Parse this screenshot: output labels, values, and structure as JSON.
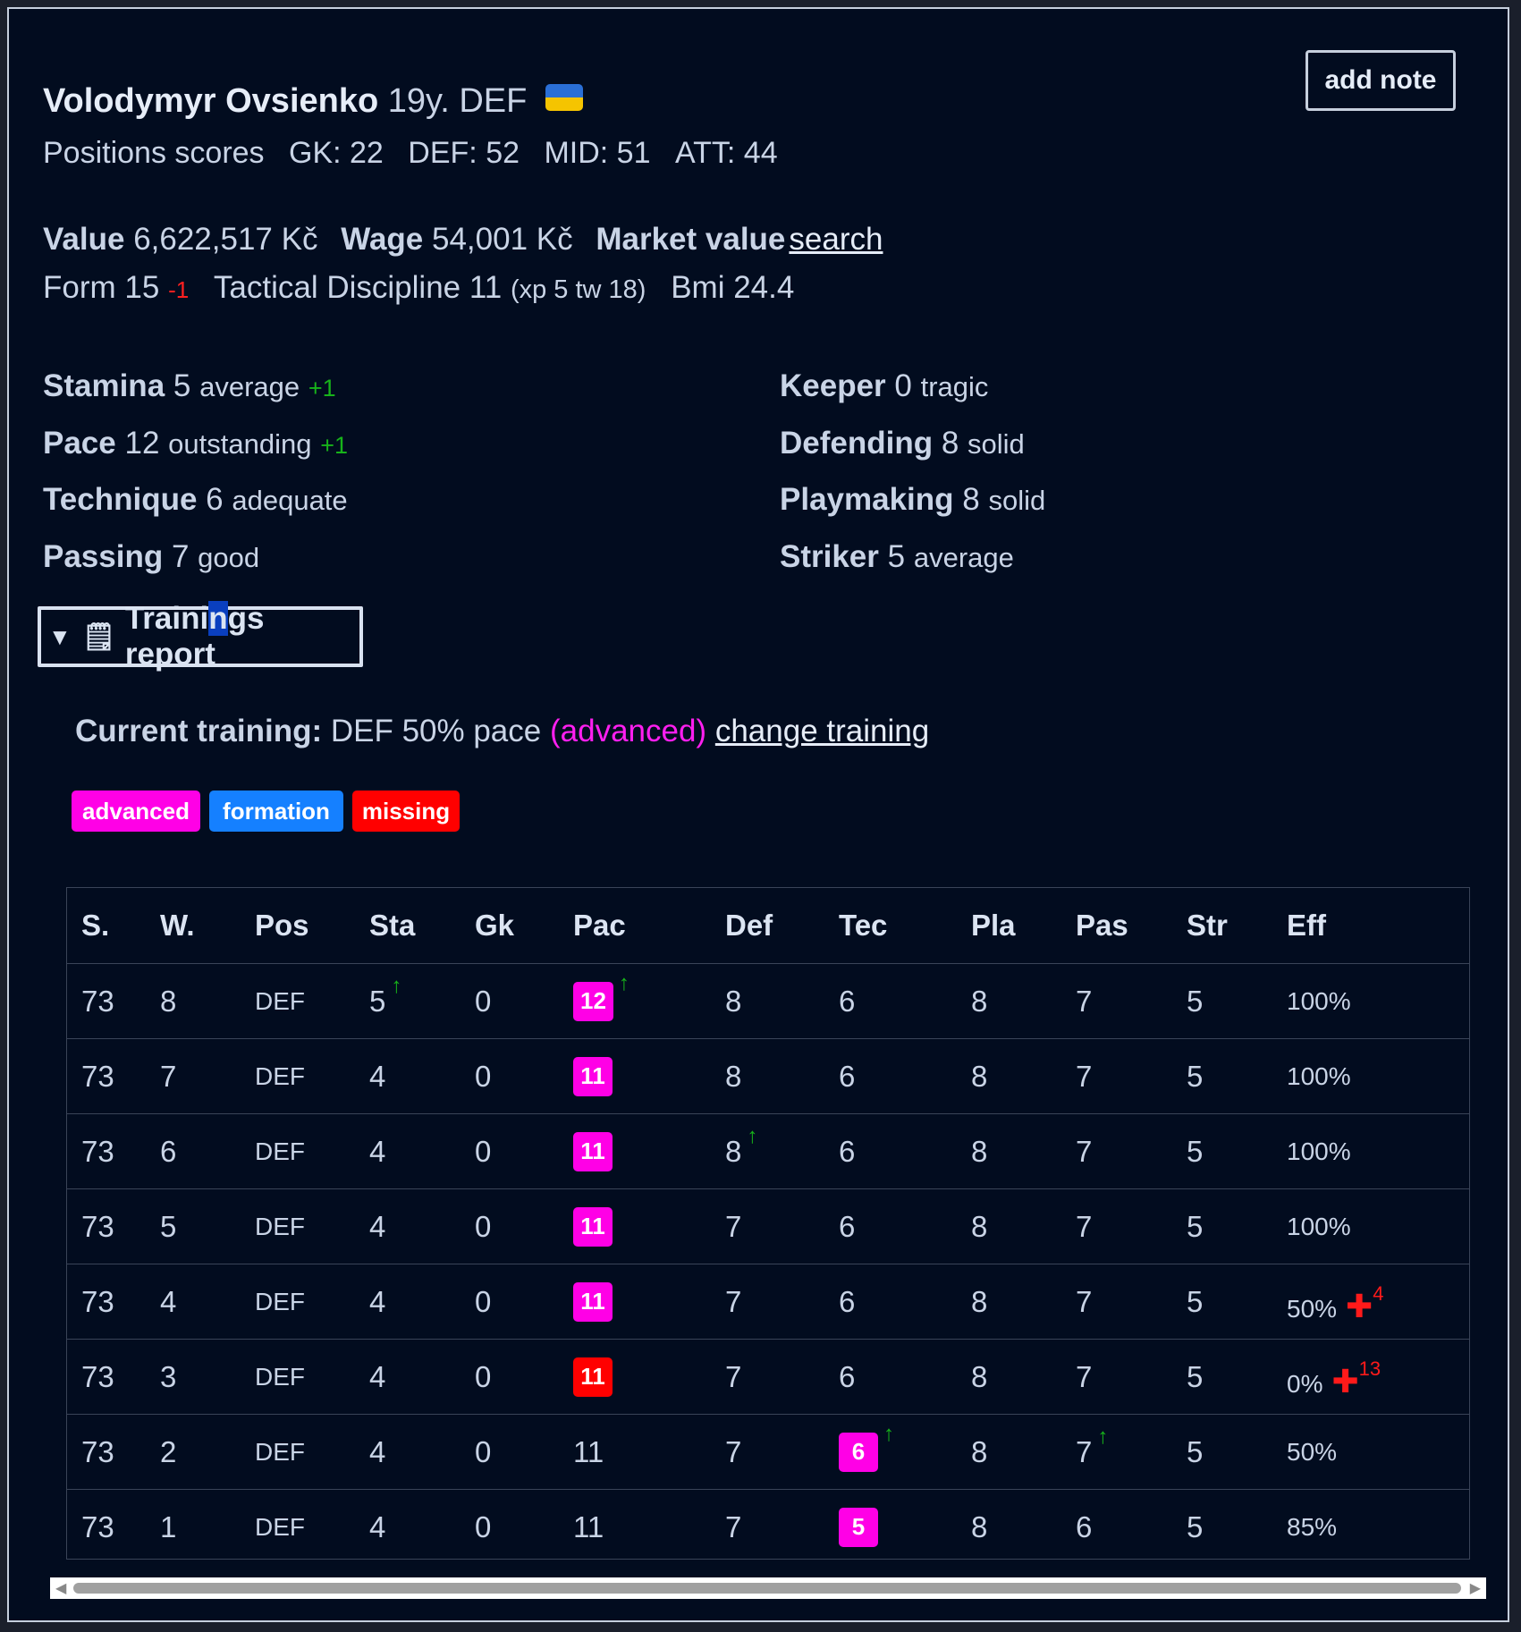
{
  "player": {
    "name": "Volodymyr Ovsienko",
    "age": "19y.",
    "position": "DEF",
    "flag": "ukraine-flag"
  },
  "add_note": "add note",
  "positions_scores": {
    "label": "Positions scores",
    "gk": "GK: 22",
    "def": "DEF: 52",
    "mid": "MID: 51",
    "att": "ATT: 44"
  },
  "finance": {
    "value_label": "Value",
    "value": "6,622,517 Kč",
    "wage_label": "Wage",
    "wage": "54,001 Kč",
    "market_label": "Market value",
    "market_link": "search"
  },
  "form": {
    "form_label": "Form",
    "form_value": "15",
    "form_change": "-1",
    "td_label": "Tactical Discipline",
    "td_value": "11",
    "td_detail": "(xp 5 tw 18)",
    "bmi_label": "Bmi",
    "bmi_value": "24.4"
  },
  "skills_left": [
    {
      "name": "Stamina",
      "value": "5",
      "desc": "average",
      "change": "+1"
    },
    {
      "name": "Pace",
      "value": "12",
      "desc": "outstanding",
      "change": "+1"
    },
    {
      "name": "Technique",
      "value": "6",
      "desc": "adequate",
      "change": ""
    },
    {
      "name": "Passing",
      "value": "7",
      "desc": "good",
      "change": ""
    }
  ],
  "skills_right": [
    {
      "name": "Keeper",
      "value": "0",
      "desc": "tragic"
    },
    {
      "name": "Defending",
      "value": "8",
      "desc": "solid"
    },
    {
      "name": "Playmaking",
      "value": "8",
      "desc": "solid"
    },
    {
      "name": "Striker",
      "value": "5",
      "desc": "average"
    }
  ],
  "trainings": {
    "summary_a": "Traini",
    "summary_b": "n",
    "summary_c": "gs report",
    "current_label": "Current training:",
    "current_value": "DEF 50% pace",
    "current_level": "(advanced)",
    "change_link": "change training",
    "tags": [
      {
        "label": "advanced",
        "color": "#ff00e6"
      },
      {
        "label": "formation",
        "color": "#1580ff"
      },
      {
        "label": "missing",
        "color": "#ff0000"
      }
    ]
  },
  "table": {
    "headers": [
      "S.",
      "W.",
      "Pos",
      "Sta",
      "Gk",
      "Pac",
      "Def",
      "Tec",
      "Pla",
      "Pas",
      "Str",
      "Eff"
    ],
    "rows": [
      {
        "s": "73",
        "w": "8",
        "pos": "DEF",
        "sta": "5",
        "sta_up": true,
        "gk": "0",
        "pac": "12",
        "pac_chip": "magenta",
        "pac_up": true,
        "def": "8",
        "def_up": false,
        "tec": "6",
        "tec_chip": "",
        "tec_up": false,
        "pla": "8",
        "pas": "7",
        "pas_up": false,
        "str": "5",
        "eff": "100%",
        "injury": ""
      },
      {
        "s": "73",
        "w": "7",
        "pos": "DEF",
        "sta": "4",
        "sta_up": false,
        "gk": "0",
        "pac": "11",
        "pac_chip": "magenta",
        "pac_up": false,
        "def": "8",
        "def_up": false,
        "tec": "6",
        "tec_chip": "",
        "tec_up": false,
        "pla": "8",
        "pas": "7",
        "pas_up": false,
        "str": "5",
        "eff": "100%",
        "injury": ""
      },
      {
        "s": "73",
        "w": "6",
        "pos": "DEF",
        "sta": "4",
        "sta_up": false,
        "gk": "0",
        "pac": "11",
        "pac_chip": "magenta",
        "pac_up": false,
        "def": "8",
        "def_up": true,
        "tec": "6",
        "tec_chip": "",
        "tec_up": false,
        "pla": "8",
        "pas": "7",
        "pas_up": false,
        "str": "5",
        "eff": "100%",
        "injury": ""
      },
      {
        "s": "73",
        "w": "5",
        "pos": "DEF",
        "sta": "4",
        "sta_up": false,
        "gk": "0",
        "pac": "11",
        "pac_chip": "magenta",
        "pac_up": false,
        "def": "7",
        "def_up": false,
        "tec": "6",
        "tec_chip": "",
        "tec_up": false,
        "pla": "8",
        "pas": "7",
        "pas_up": false,
        "str": "5",
        "eff": "100%",
        "injury": ""
      },
      {
        "s": "73",
        "w": "4",
        "pos": "DEF",
        "sta": "4",
        "sta_up": false,
        "gk": "0",
        "pac": "11",
        "pac_chip": "magenta",
        "pac_up": false,
        "def": "7",
        "def_up": false,
        "tec": "6",
        "tec_chip": "",
        "tec_up": false,
        "pla": "8",
        "pas": "7",
        "pas_up": false,
        "str": "5",
        "eff": "50%",
        "injury": "4"
      },
      {
        "s": "73",
        "w": "3",
        "pos": "DEF",
        "sta": "4",
        "sta_up": false,
        "gk": "0",
        "pac": "11",
        "pac_chip": "red",
        "pac_up": false,
        "def": "7",
        "def_up": false,
        "tec": "6",
        "tec_chip": "",
        "tec_up": false,
        "pla": "8",
        "pas": "7",
        "pas_up": false,
        "str": "5",
        "eff": "0%",
        "injury": "13"
      },
      {
        "s": "73",
        "w": "2",
        "pos": "DEF",
        "sta": "4",
        "sta_up": false,
        "gk": "0",
        "pac": "11",
        "pac_chip": "",
        "pac_up": false,
        "def": "7",
        "def_up": false,
        "tec": "6",
        "tec_chip": "magenta",
        "tec_up": true,
        "pla": "8",
        "pas": "7",
        "pas_up": true,
        "str": "5",
        "eff": "50%",
        "injury": ""
      },
      {
        "s": "73",
        "w": "1",
        "pos": "DEF",
        "sta": "4",
        "sta_up": false,
        "gk": "0",
        "pac": "11",
        "pac_chip": "",
        "pac_up": false,
        "def": "7",
        "def_up": false,
        "tec": "5",
        "tec_chip": "magenta",
        "tec_up": false,
        "pla": "8",
        "pas": "6",
        "pas_up": false,
        "str": "5",
        "eff": "85%",
        "injury": ""
      }
    ],
    "up_arrow": "↑",
    "injury_icon": "✚"
  }
}
